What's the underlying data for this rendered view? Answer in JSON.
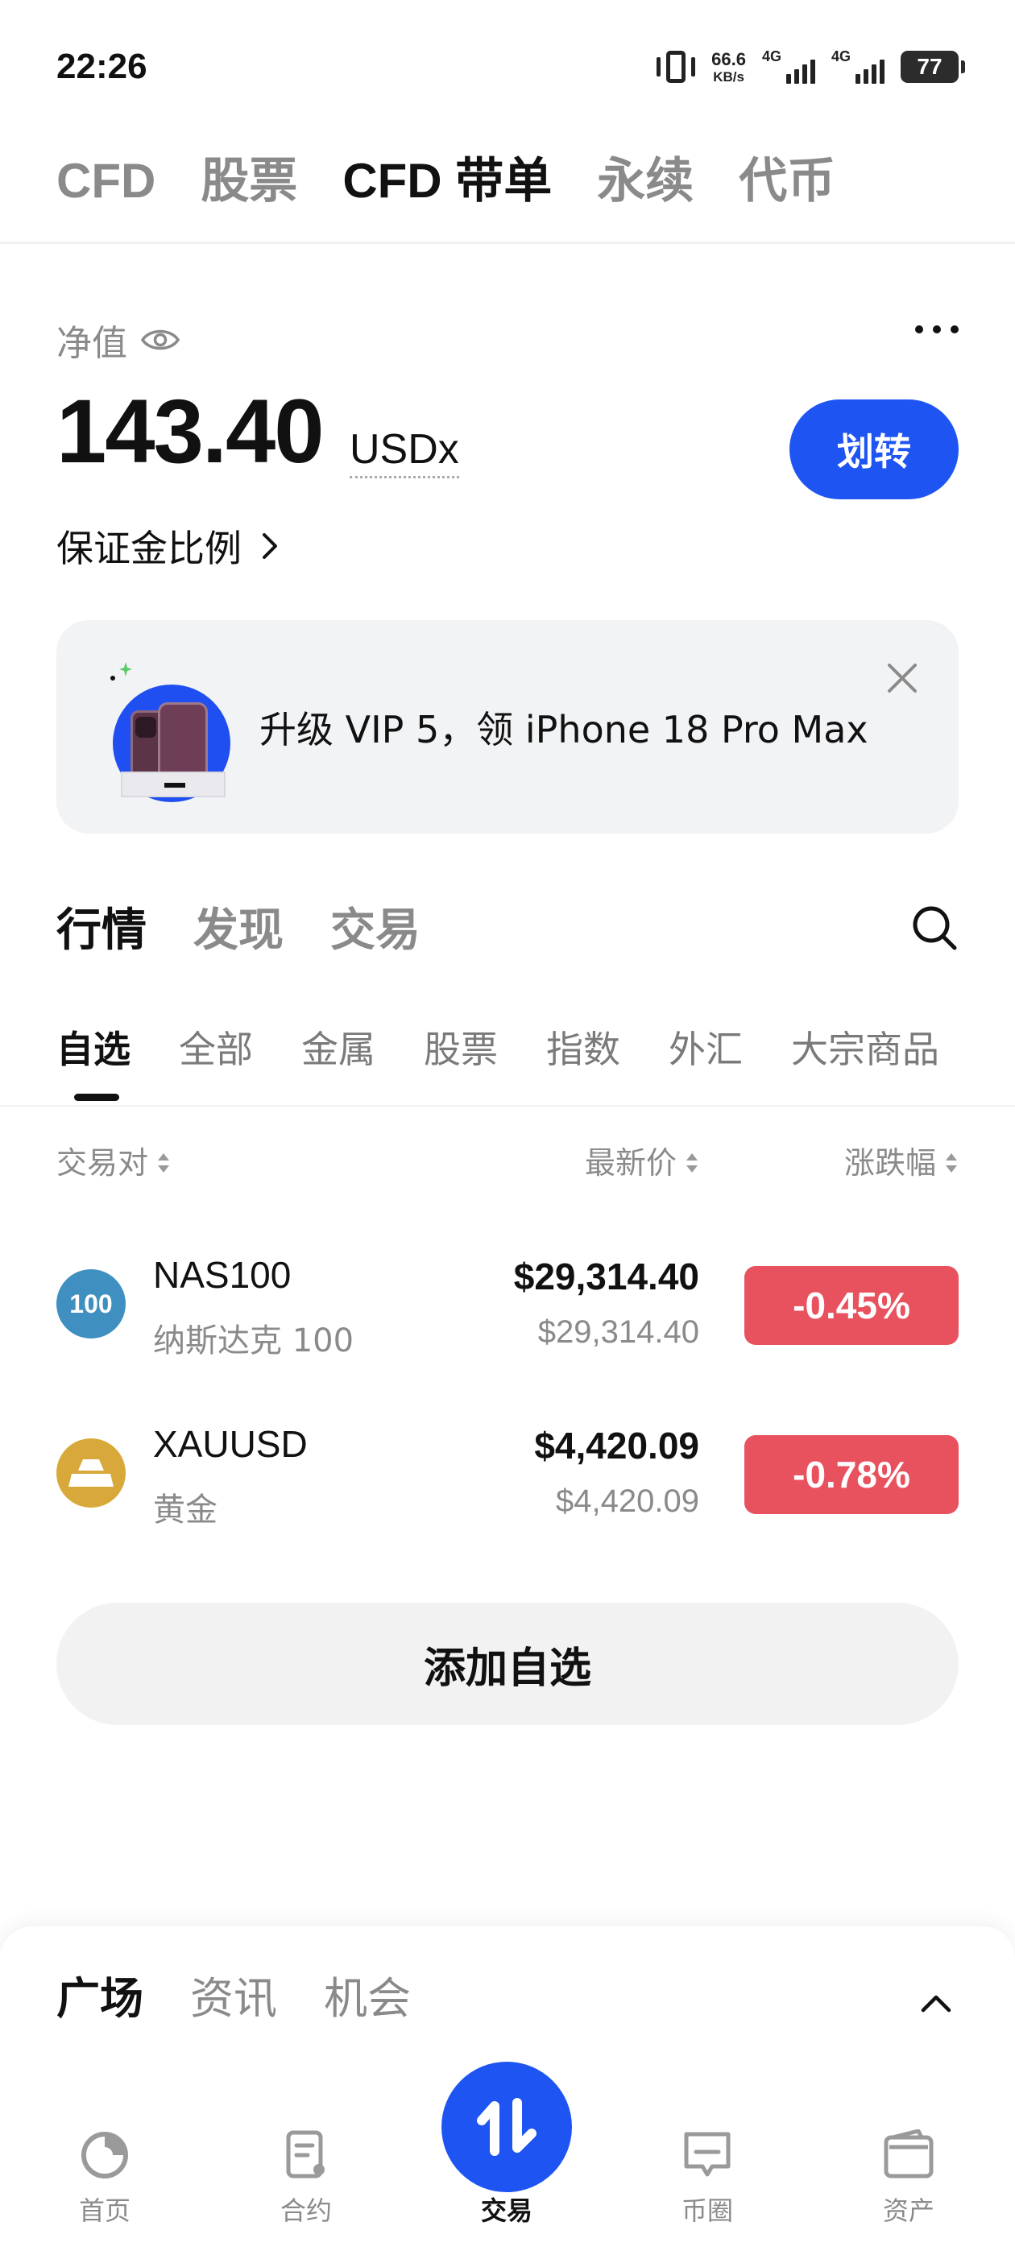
{
  "status_bar": {
    "time": "22:26",
    "net_speed_value": "66.6",
    "net_speed_unit": "KB/s",
    "signal1_tag": "4G",
    "signal2_tag": "4G",
    "battery": "77"
  },
  "top_tabs": [
    {
      "label": "CFD",
      "active": false
    },
    {
      "label": "股票",
      "active": false
    },
    {
      "label": "CFD 带单",
      "active": true
    },
    {
      "label": "永续",
      "active": false
    },
    {
      "label": "代币",
      "active": false
    }
  ],
  "account": {
    "net_value_label": "净值",
    "amount": "143.40",
    "unit": "USDx",
    "transfer_label": "划转",
    "margin_ratio_label": "保证金比例"
  },
  "promo": {
    "text": "升级 VIP 5，领 iPhone 18 Pro Max"
  },
  "section_tabs": [
    {
      "label": "行情",
      "active": true
    },
    {
      "label": "发现",
      "active": false
    },
    {
      "label": "交易",
      "active": false
    }
  ],
  "category_tabs": [
    {
      "label": "自选",
      "active": true
    },
    {
      "label": "全部",
      "active": false
    },
    {
      "label": "金属",
      "active": false
    },
    {
      "label": "股票",
      "active": false
    },
    {
      "label": "指数",
      "active": false
    },
    {
      "label": "外汇",
      "active": false
    },
    {
      "label": "大宗商品",
      "active": false
    }
  ],
  "columns": {
    "pair": "交易对",
    "price": "最新价",
    "change": "涨跌幅"
  },
  "rows": [
    {
      "icon_text": "100",
      "icon_color": "#3f8fc0",
      "symbol": "NAS100",
      "name": "纳斯达克 100",
      "price": "$29,314.40",
      "sub_price": "$29,314.40",
      "change": "-0.45%"
    },
    {
      "icon_text": "",
      "icon_color": "#d8a93a",
      "symbol": "XAUUSD",
      "name": "黄金",
      "price": "$4,420.09",
      "sub_price": "$4,420.09",
      "change": "-0.78%"
    }
  ],
  "add_watchlist_label": "添加自选",
  "sheet_tabs": [
    {
      "label": "广场",
      "active": true
    },
    {
      "label": "资讯",
      "active": false
    },
    {
      "label": "机会",
      "active": false
    }
  ],
  "bottom_nav": [
    {
      "label": "首页",
      "icon": "home-icon"
    },
    {
      "label": "合约",
      "icon": "contract-icon"
    },
    {
      "label": "交易",
      "icon": "trade-icon",
      "active": true
    },
    {
      "label": "币圈",
      "icon": "community-icon"
    },
    {
      "label": "资产",
      "icon": "wallet-icon"
    }
  ],
  "colors": {
    "accent": "#1e55f2",
    "negative": "#e8525f"
  }
}
